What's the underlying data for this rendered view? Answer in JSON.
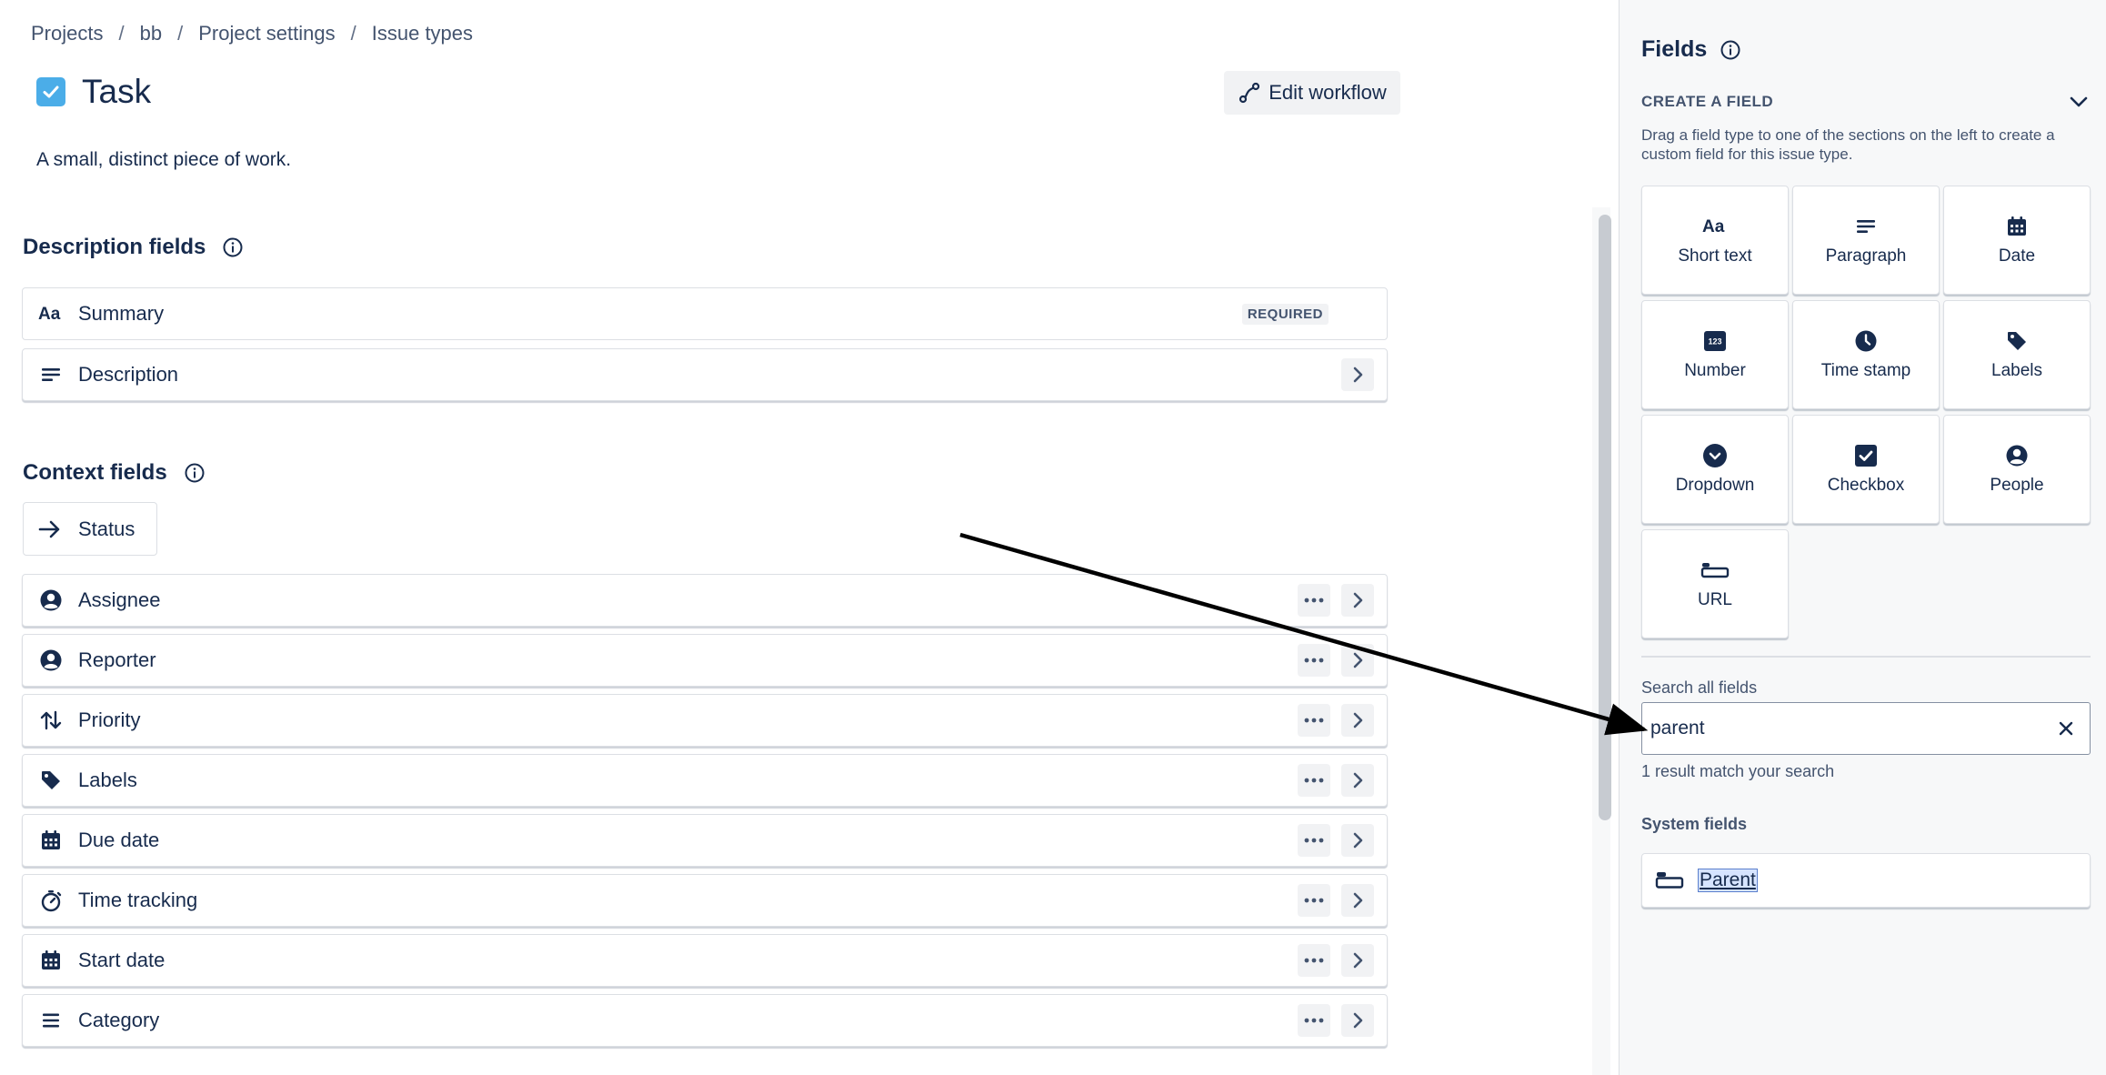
{
  "breadcrumb": [
    "Projects",
    "bb",
    "Project settings",
    "Issue types"
  ],
  "issue_type": {
    "title": "Task",
    "description": "A small, distinct piece of work.",
    "icon": "task-checkbox-icon",
    "icon_color": "#4BADE8"
  },
  "toolbar": {
    "edit_workflow_label": "Edit workflow"
  },
  "description_fields": {
    "title": "Description fields",
    "items": [
      {
        "label": "Summary",
        "icon": "text-aa-icon",
        "badge": "REQUIRED"
      },
      {
        "label": "Description",
        "icon": "paragraph-icon"
      }
    ]
  },
  "context_fields": {
    "title": "Context fields",
    "status_label": "Status",
    "items": [
      {
        "label": "Assignee",
        "icon": "person-icon"
      },
      {
        "label": "Reporter",
        "icon": "person-icon"
      },
      {
        "label": "Priority",
        "icon": "priority-arrows-icon"
      },
      {
        "label": "Labels",
        "icon": "tag-icon"
      },
      {
        "label": "Due date",
        "icon": "calendar-icon"
      },
      {
        "label": "Time tracking",
        "icon": "stopwatch-icon"
      },
      {
        "label": "Start date",
        "icon": "calendar-icon"
      },
      {
        "label": "Category",
        "icon": "list-icon"
      }
    ]
  },
  "panel": {
    "title": "Fields",
    "create_heading": "CREATE A FIELD",
    "create_description": "Drag a field type to one of the sections on the left to create a custom field for this issue type.",
    "field_types": [
      {
        "label": "Short text",
        "icon": "text-aa-icon"
      },
      {
        "label": "Paragraph",
        "icon": "paragraph-icon"
      },
      {
        "label": "Date",
        "icon": "calendar-icon"
      },
      {
        "label": "Number",
        "icon": "number-123-icon"
      },
      {
        "label": "Time stamp",
        "icon": "clock-icon"
      },
      {
        "label": "Labels",
        "icon": "tag-icon"
      },
      {
        "label": "Dropdown",
        "icon": "dropdown-circle-icon"
      },
      {
        "label": "Checkbox",
        "icon": "checkbox-icon"
      },
      {
        "label": "People",
        "icon": "person-icon"
      },
      {
        "label": "URL",
        "icon": "url-field-icon"
      }
    ],
    "search": {
      "label": "Search all fields",
      "value": "parent",
      "result_text": "1 result match your search"
    },
    "system_fields": {
      "heading": "System fields",
      "items": [
        {
          "label": "Parent",
          "icon": "parent-field-icon"
        }
      ]
    }
  },
  "colors": {
    "text_primary": "#172B4D",
    "text_subtle": "#44546F",
    "panel_bg": "#F7F8F9",
    "button_bg": "#F1F2F4",
    "border": "#DCDFE4",
    "selection_bg": "#D6E4FF"
  }
}
